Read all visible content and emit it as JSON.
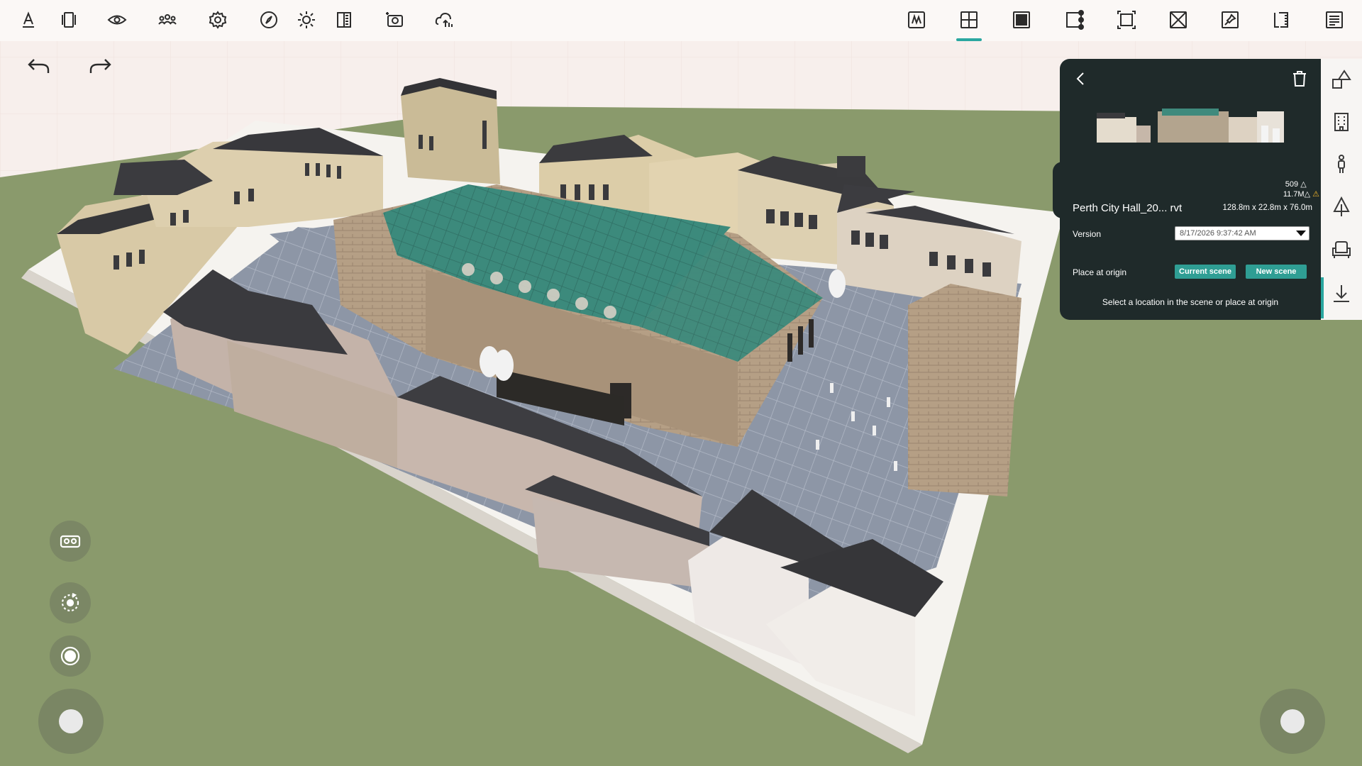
{
  "toolbar_left": [
    {
      "icon": "text-style-icon"
    },
    {
      "icon": "layers-icon"
    },
    {
      "icon": "eye-icon"
    },
    {
      "icon": "people-icon"
    },
    {
      "icon": "settings-gear-icon"
    },
    {
      "icon": "compass-icon"
    },
    {
      "icon": "sun-icon"
    },
    {
      "icon": "section-icon"
    },
    {
      "icon": "camera-capture-icon"
    },
    {
      "icon": "cloud-upload-icon"
    }
  ],
  "toolbar_right": [
    {
      "icon": "sketch-icon"
    },
    {
      "icon": "add-object-icon",
      "active": true
    },
    {
      "icon": "fill-square-icon"
    },
    {
      "icon": "node-edit-icon"
    },
    {
      "icon": "transform-icon"
    },
    {
      "icon": "delete-box-icon"
    },
    {
      "icon": "pin-icon"
    },
    {
      "icon": "measure-icon"
    },
    {
      "icon": "report-icon"
    }
  ],
  "colors": {
    "accent": "#2aa7a0",
    "panel_bg": "#1f2a2a",
    "button_teal": "#2f9e94",
    "ground": "#8a9a6c",
    "warning": "#f0b429"
  },
  "panel": {
    "stats_line1": "509",
    "stats_line2": "11.7M",
    "file_name": "Perth City Hall_20... rvt",
    "dimensions": "128.8m x 22.8m x 76.0m",
    "version_label": "Version",
    "version_value": "8/17/2026 9:37:42 AM",
    "place_label": "Place at origin",
    "current_scene_button": "Current scene",
    "new_scene_button": "New scene",
    "hint": "Select a location in the scene or place at origin"
  },
  "rail": [
    {
      "icon": "shapes-icon"
    },
    {
      "icon": "building-icon"
    },
    {
      "icon": "person-icon"
    },
    {
      "icon": "tree-icon"
    },
    {
      "icon": "armchair-icon"
    },
    {
      "icon": "download-icon",
      "active": true
    }
  ]
}
